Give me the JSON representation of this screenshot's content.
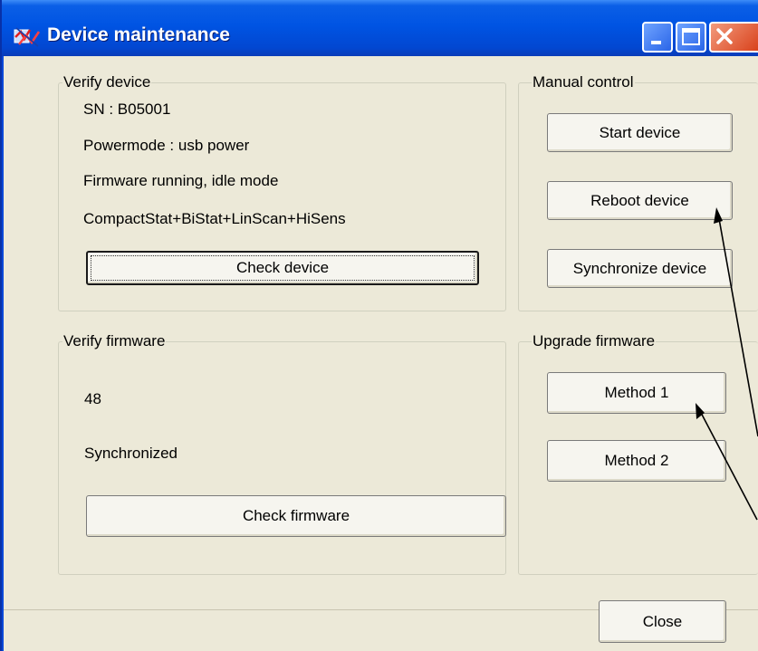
{
  "window": {
    "title": "Device maintenance"
  },
  "verify_device": {
    "legend": "Verify device",
    "serial": "SN : B05001",
    "powermode": "Powermode : usb power",
    "status": "Firmware running, idle mode",
    "features": "CompactStat+BiStat+LinScan+HiSens",
    "check_button": "Check device"
  },
  "manual_control": {
    "legend": "Manual control",
    "start_button": "Start device",
    "reboot_button": "Reboot device",
    "sync_button": "Synchronize device"
  },
  "verify_firmware": {
    "legend": "Verify firmware",
    "version": "48",
    "status": "Synchronized",
    "check_button": "Check firmware"
  },
  "upgrade_firmware": {
    "legend": "Upgrade firmware",
    "method1_button": "Method 1",
    "method2_button": "Method 2"
  },
  "footer": {
    "close_button": "Close"
  },
  "colors": {
    "titlebar": "#0054e3",
    "dialog_bg": "#ece9d8",
    "close_button": "#d9421c"
  },
  "icons": [
    "app-icon",
    "minimize-icon",
    "maximize-icon",
    "close-icon"
  ]
}
